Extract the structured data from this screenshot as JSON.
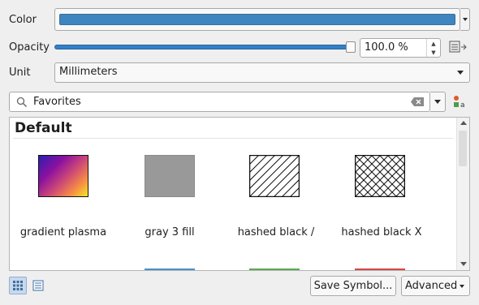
{
  "color": {
    "label": "Color",
    "value": "#3f86c1"
  },
  "opacity": {
    "label": "Opacity",
    "value": "100.0 %",
    "fraction": 1.0
  },
  "unit": {
    "label": "Unit",
    "value": "Millimeters"
  },
  "search": {
    "value": "Favorites"
  },
  "library": {
    "group": "Default",
    "items": [
      {
        "label": "gradient   plasma",
        "kind": "gradient"
      },
      {
        "label": "gray 3 fill",
        "kind": "gray"
      },
      {
        "label": "hashed black /",
        "kind": "hatch"
      },
      {
        "label": "hashed black X",
        "kind": "crosshatch"
      }
    ],
    "next_row_colors": [
      "#4a90c8",
      "#5aaa52",
      "#d64545"
    ]
  },
  "footer": {
    "save_label": "Save Symbol...",
    "advanced_label": "Advanced"
  }
}
